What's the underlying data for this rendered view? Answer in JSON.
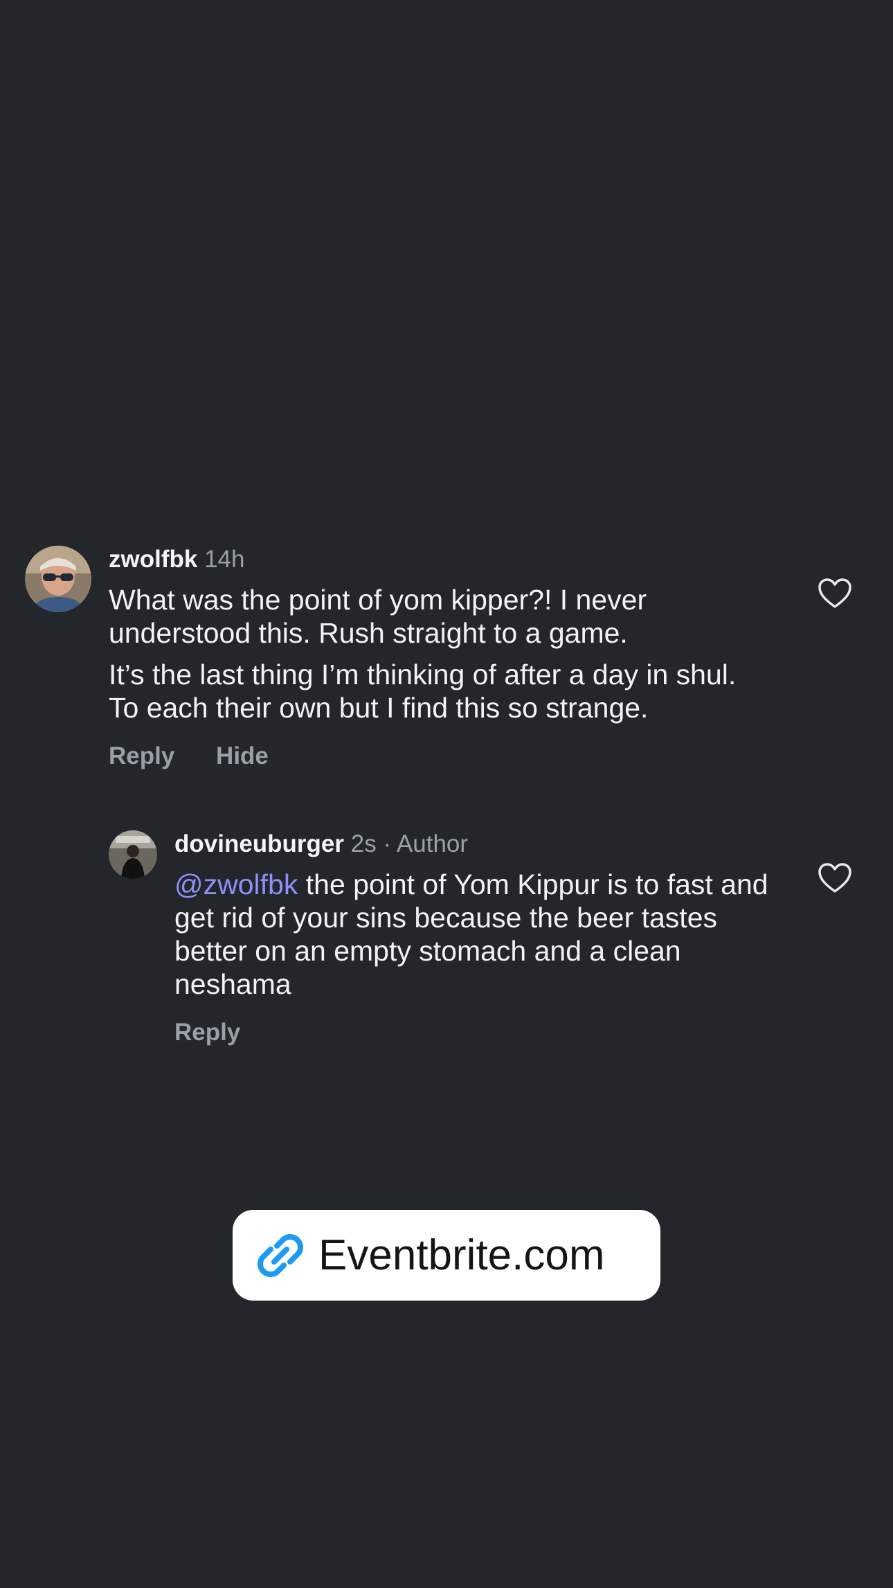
{
  "comments": [
    {
      "username": "zwolfbk",
      "time": "14h",
      "paragraphs": [
        "What was the point of yom kipper?! I never understood this. Rush straight to a game.",
        "It’s the last thing I’m thinking of after a day in shul. To each their own but I find this so strange."
      ],
      "actions": {
        "reply": "Reply",
        "hide": "Hide"
      }
    },
    {
      "username": "dovineuburger",
      "time": "2s",
      "separator": "·",
      "author_tag": "Author",
      "mention": "@zwolfbk",
      "text": "the point of Yom Kippur is to fast and get rid of your sins because the beer tastes better on an empty stomach and a clean neshama",
      "actions": {
        "reply": "Reply"
      }
    }
  ],
  "link_sticker": {
    "icon": "link-icon",
    "label": "Eventbrite.com",
    "icon_color": "#1d9bf0"
  },
  "colors": {
    "background": "#23262a",
    "mention": "#8f90f5",
    "secondary_text": "#9aa0a8"
  }
}
